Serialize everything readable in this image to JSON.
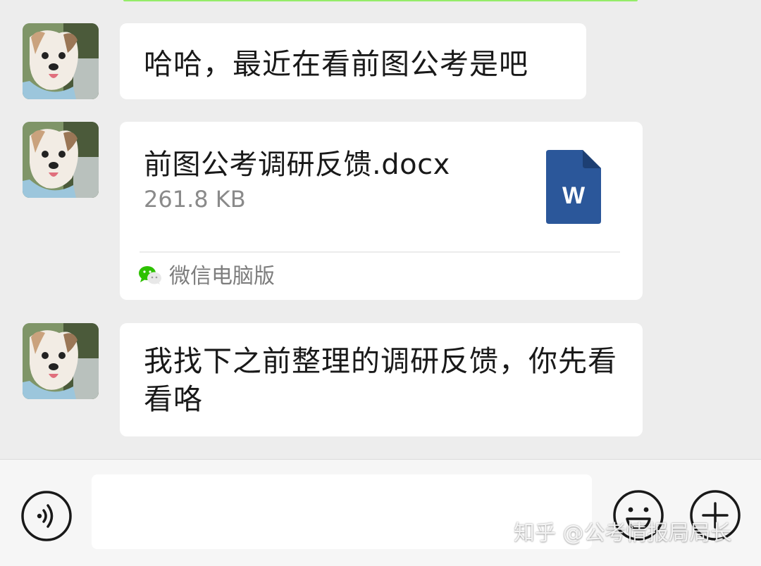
{
  "messages": [
    {
      "type": "text",
      "text": "哈哈，最近在看前图公考是吧"
    },
    {
      "type": "file",
      "file_name": "前图公考调研反馈.docx",
      "file_size": "261.8 KB",
      "file_icon": "word-document-icon",
      "file_icon_letter": "W",
      "source_label": "微信电脑版",
      "source_icon": "wechat-logo-icon"
    },
    {
      "type": "text",
      "text": "我找下之前整理的调研反馈，你先看看咯"
    }
  ],
  "avatar": {
    "icon": "dog-avatar-icon"
  },
  "input_bar": {
    "voice_icon": "voice-icon",
    "emoji_icon": "emoji-icon",
    "plus_icon": "plus-icon",
    "input_value": ""
  },
  "watermark": "知乎 @公考情报局局长",
  "colors": {
    "background": "#ededed",
    "bubble": "#ffffff",
    "word_blue": "#2b579a",
    "wechat_green": "#07c160"
  }
}
